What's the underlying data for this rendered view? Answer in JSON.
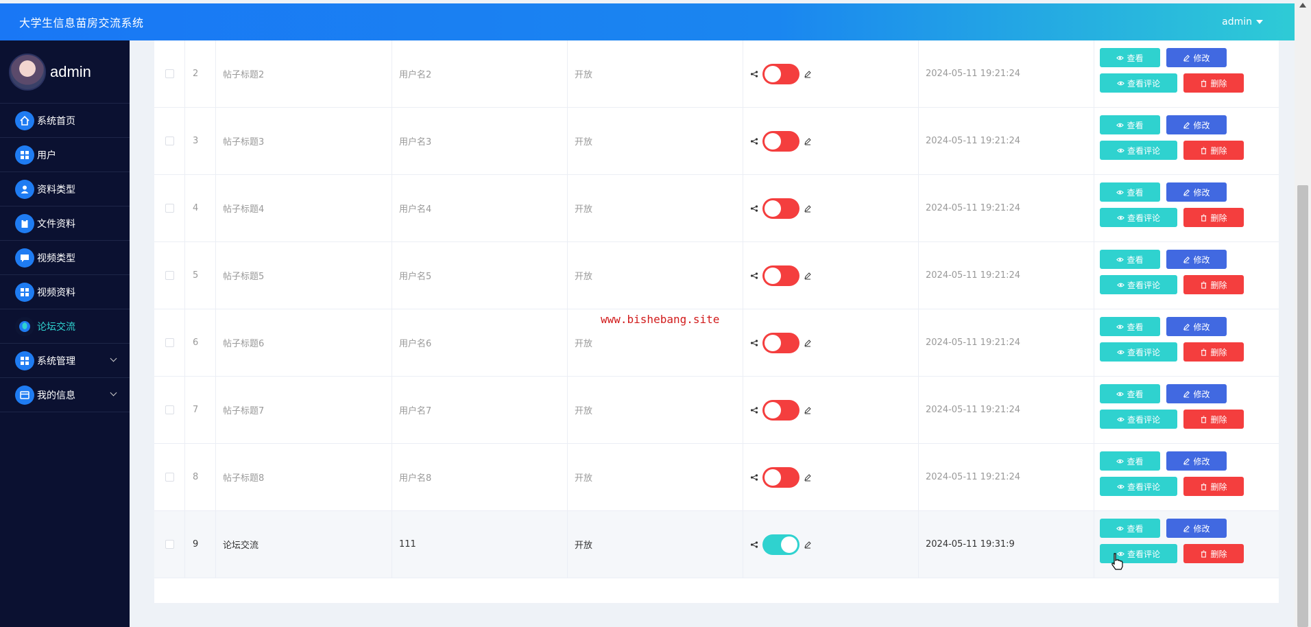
{
  "header": {
    "title": "大学生信息苗房交流系统",
    "user": "admin"
  },
  "sidebar": {
    "username": "admin",
    "items": [
      {
        "label": "系统首页",
        "icon": "home-icon"
      },
      {
        "label": "用户",
        "icon": "grid-icon"
      },
      {
        "label": "资料类型",
        "icon": "user-icon"
      },
      {
        "label": "文件资料",
        "icon": "clipboard-icon"
      },
      {
        "label": "视频类型",
        "icon": "chat-icon"
      },
      {
        "label": "视频资料",
        "icon": "grid-icon"
      },
      {
        "label": "论坛交流",
        "icon": "forum-icon",
        "active": true
      },
      {
        "label": "系统管理",
        "icon": "grid-icon",
        "expandable": true
      },
      {
        "label": "我的信息",
        "icon": "card-icon",
        "expandable": true
      }
    ]
  },
  "table": {
    "rows": [
      {
        "index": "2",
        "title": "帖子标题2",
        "user": "用户名2",
        "status": "开放",
        "enabled": false,
        "time": "2024-05-11 19:21:24"
      },
      {
        "index": "3",
        "title": "帖子标题3",
        "user": "用户名3",
        "status": "开放",
        "enabled": false,
        "time": "2024-05-11 19:21:24"
      },
      {
        "index": "4",
        "title": "帖子标题4",
        "user": "用户名4",
        "status": "开放",
        "enabled": false,
        "time": "2024-05-11 19:21:24"
      },
      {
        "index": "5",
        "title": "帖子标题5",
        "user": "用户名5",
        "status": "开放",
        "enabled": false,
        "time": "2024-05-11 19:21:24"
      },
      {
        "index": "6",
        "title": "帖子标题6",
        "user": "用户名6",
        "status": "开放",
        "enabled": false,
        "time": "2024-05-11 19:21:24"
      },
      {
        "index": "7",
        "title": "帖子标题7",
        "user": "用户名7",
        "status": "开放",
        "enabled": false,
        "time": "2024-05-11 19:21:24"
      },
      {
        "index": "8",
        "title": "帖子标题8",
        "user": "用户名8",
        "status": "开放",
        "enabled": false,
        "time": "2024-05-11 19:21:24"
      },
      {
        "index": "9",
        "title": "论坛交流",
        "user": "111",
        "status": "开放",
        "enabled": true,
        "time": "2024-05-11 19:31:9"
      }
    ],
    "actions": {
      "view": "查看",
      "edit": "修改",
      "comments": "查看评论",
      "delete": "删除"
    }
  },
  "watermark": "www.bishebang.site",
  "colors": {
    "accent": "#2fd2cf",
    "primary": "#4169e1",
    "danger": "#f43e3e",
    "sidebar": "#0b1131"
  }
}
